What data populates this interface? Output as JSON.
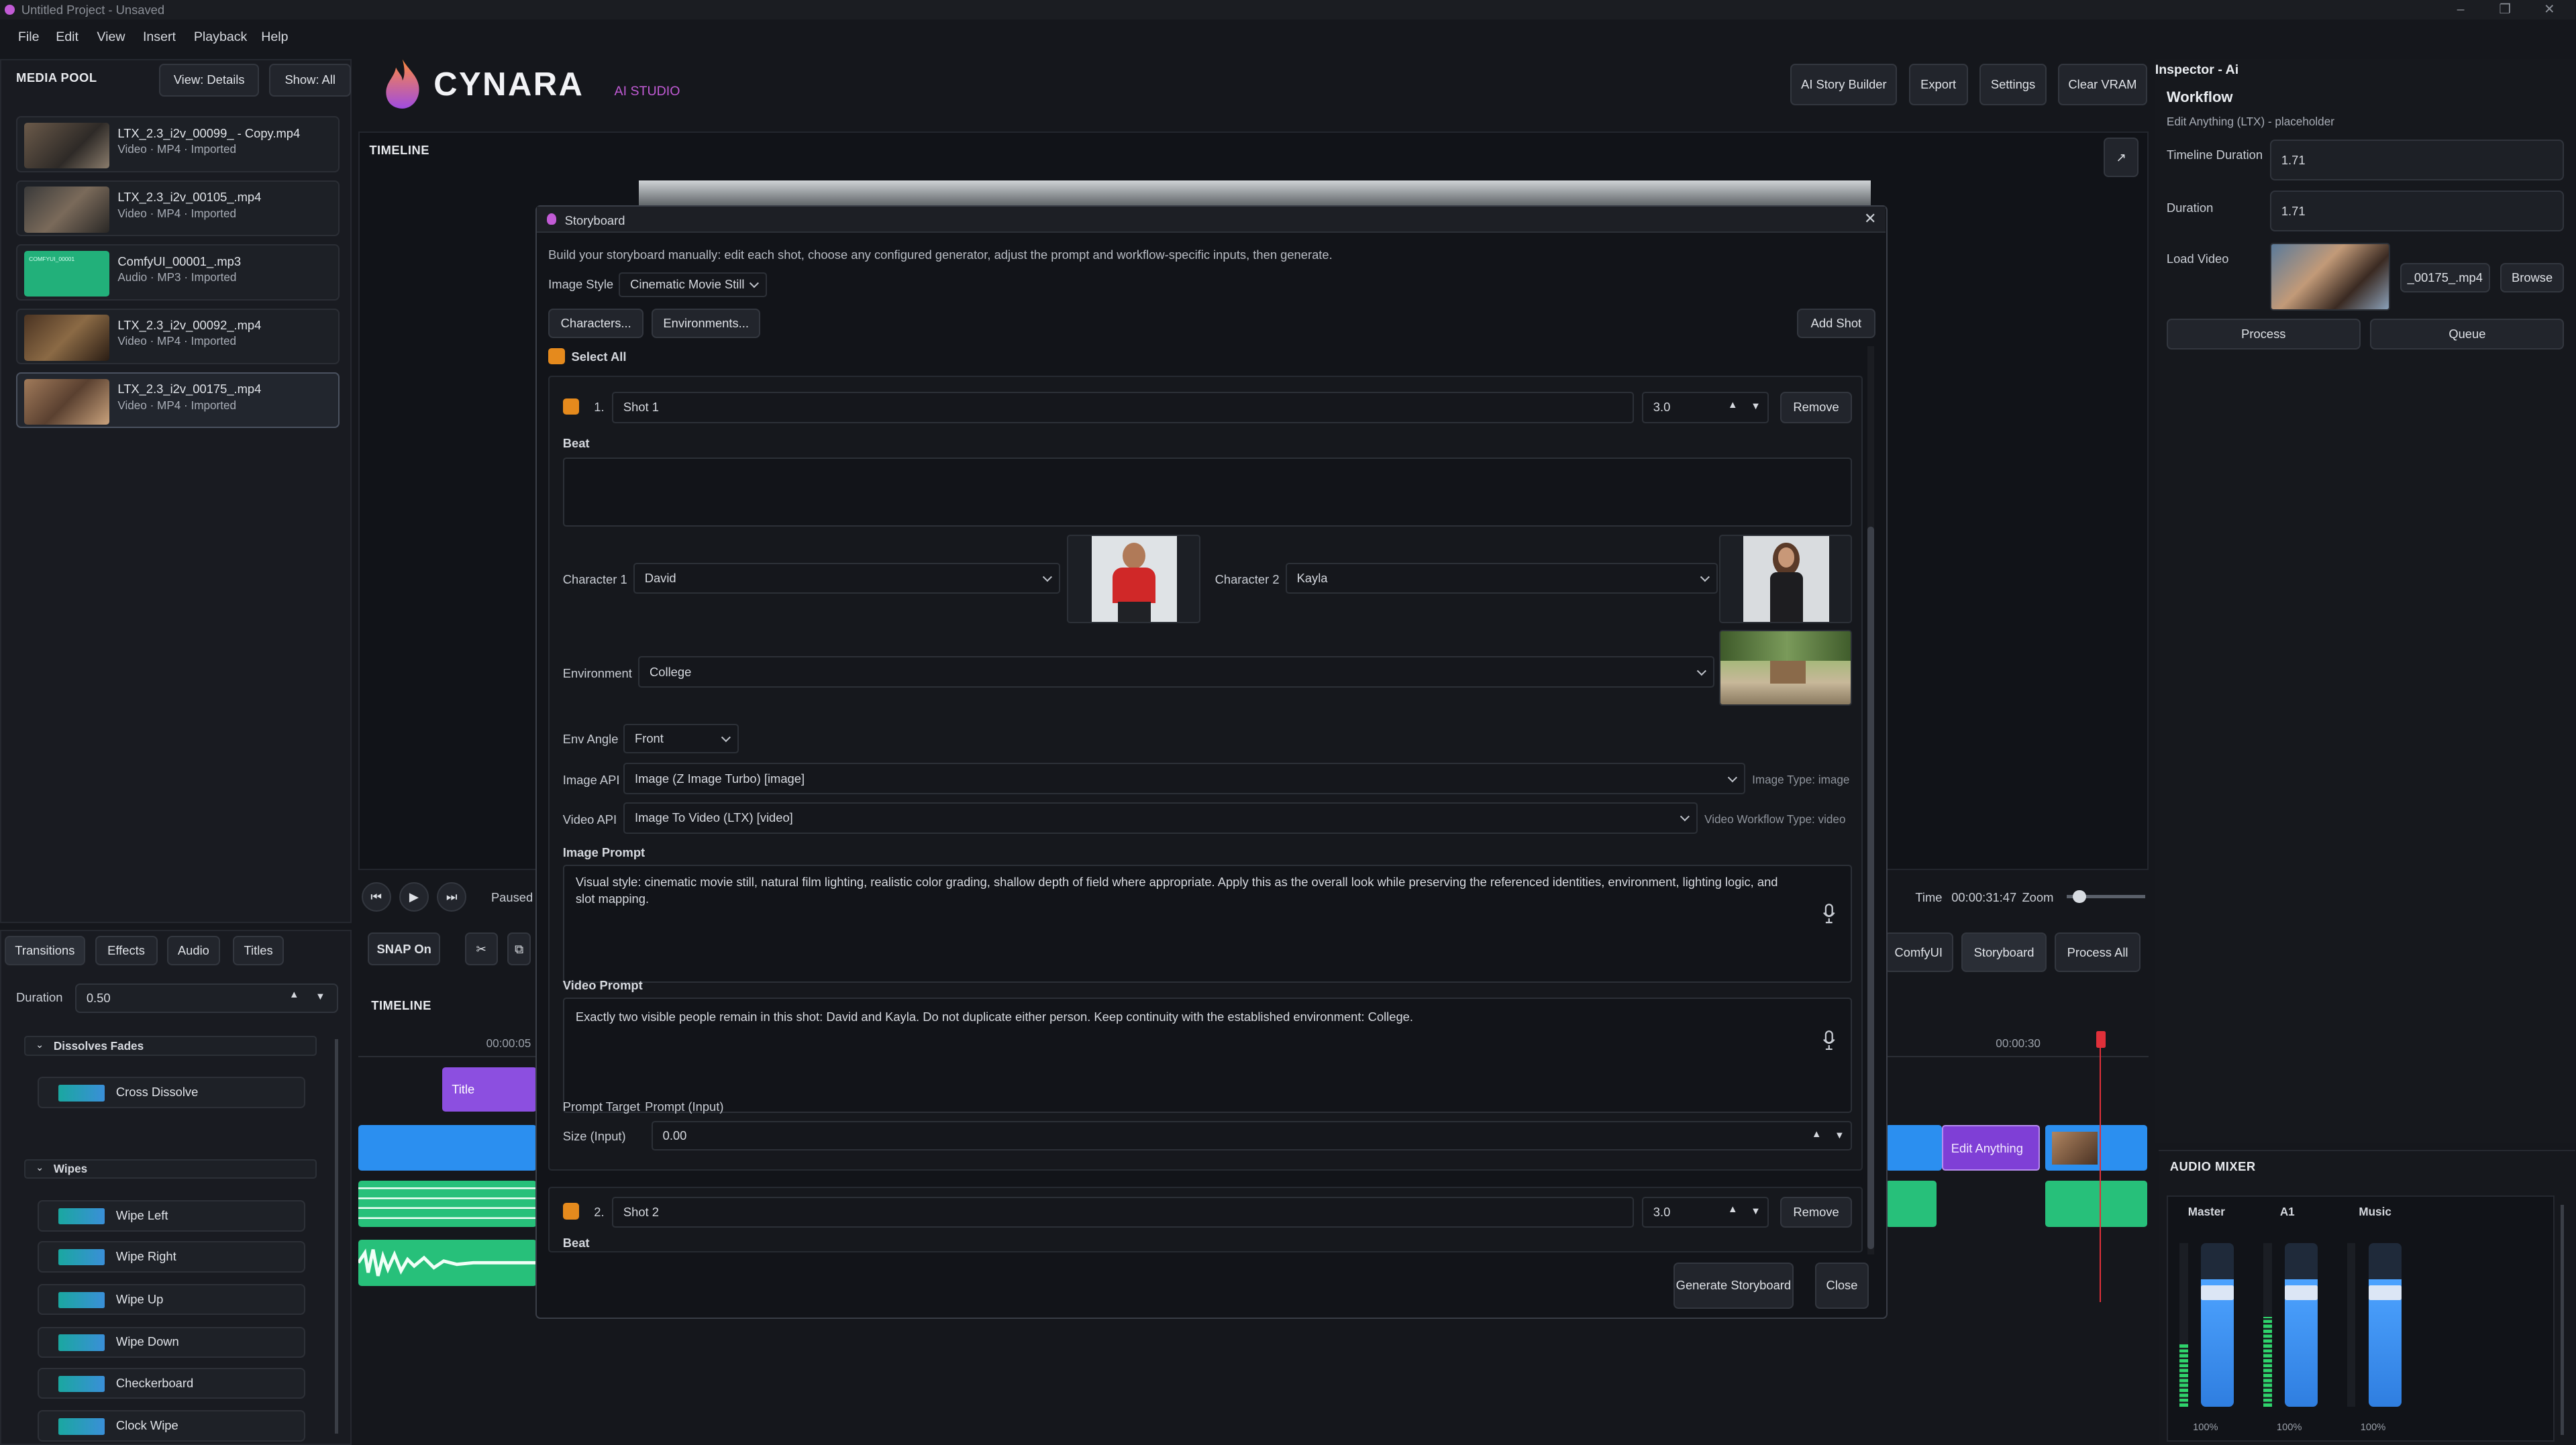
{
  "window": {
    "title": "Untitled Project - Unsaved"
  },
  "menu": [
    "File",
    "Edit",
    "View",
    "Insert",
    "Playback",
    "Help"
  ],
  "media_pool": {
    "title": "MEDIA POOL",
    "view_btn": "View: Details",
    "show_btn": "Show: All",
    "items": [
      {
        "name": "LTX_2.3_i2v_00099_ - Copy.mp4",
        "meta": "Video · MP4 · Imported"
      },
      {
        "name": "LTX_2.3_i2v_00105_.mp4",
        "meta": "Video · MP4 · Imported"
      },
      {
        "name": "ComfyUI_00001_.mp3",
        "meta": "Audio · MP3 · Imported",
        "thumb_text": "COMFYUI_00001"
      },
      {
        "name": "LTX_2.3_i2v_00092_.mp4",
        "meta": "Video · MP4 · Imported"
      },
      {
        "name": "LTX_2.3_i2v_00175_.mp4",
        "meta": "Video · MP4 · Imported"
      }
    ]
  },
  "effects_panel": {
    "tabs": [
      "Transitions",
      "Effects",
      "Audio",
      "Titles"
    ],
    "duration_label": "Duration",
    "duration_value": "0.50",
    "groups": [
      {
        "name": "Dissolves  Fades",
        "items": [
          "Cross Dissolve"
        ]
      },
      {
        "name": "Wipes",
        "items": [
          "Wipe Left",
          "Wipe Right",
          "Wipe Up",
          "Wipe Down",
          "Checkerboard",
          "Clock Wipe"
        ]
      }
    ]
  },
  "brand": {
    "name": "CYNARA",
    "sub": "AI STUDIO"
  },
  "toolbar": {
    "story": "AI Story Builder",
    "export": "Export",
    "settings": "Settings",
    "clear": "Clear VRAM"
  },
  "preview": {
    "label": "TIMELINE",
    "status": "Paused",
    "time_label": "Time",
    "time_value": "00:00:31:47",
    "zoom_label": "Zoom"
  },
  "timeline": {
    "label": "TIMELINE",
    "snap": "SNAP On",
    "comfy": "ComfyUI",
    "storyboard": "Storyboard",
    "process_all": "Process All",
    "ticks": [
      "00:00:05",
      "00:00:30"
    ],
    "title_clip": "Title",
    "edit_clip": "Edit Anything"
  },
  "inspector": {
    "title": "Inspector - Ai",
    "section": "Workflow",
    "subtitle": "Edit Anything (LTX) - placeholder",
    "timeline_duration_label": "Timeline Duration",
    "timeline_duration": "1.71",
    "duration_label": "Duration",
    "duration": "1.71",
    "load_video_label": "Load Video",
    "file": "_00175_.mp4",
    "browse": "Browse",
    "process": "Process",
    "queue": "Queue"
  },
  "mixer": {
    "title": "AUDIO MIXER",
    "channels": [
      {
        "name": "Master",
        "value": "100%"
      },
      {
        "name": "A1",
        "value": "100%"
      },
      {
        "name": "Music",
        "value": "100%"
      }
    ]
  },
  "storyboard": {
    "title": "Storyboard",
    "intro": "Build your storyboard manually: edit each shot, choose any configured generator, adjust the prompt and workflow-specific inputs, then generate.",
    "image_style_label": "Image Style",
    "image_style": "Cinematic Movie Still",
    "characters_btn": "Characters...",
    "environments_btn": "Environments...",
    "add_shot": "Add Shot",
    "select_all": "Select All",
    "shot1": {
      "num": "1.",
      "name": "Shot 1",
      "duration": "3.0",
      "remove": "Remove",
      "beat_label": "Beat",
      "char1_label": "Character 1",
      "char1": "David",
      "char2_label": "Character 2",
      "char2": "Kayla",
      "env_label": "Environment",
      "env": "College",
      "env_angle_label": "Env Angle",
      "env_angle": "Front",
      "image_api_label": "Image API",
      "image_api": "Image (Z Image Turbo) [image]",
      "image_type": "Image Type: image",
      "video_api_label": "Video API",
      "video_api": "Image To Video (LTX) [video]",
      "video_type": "Video Workflow Type: video",
      "image_prompt_label": "Image Prompt",
      "image_prompt": "Visual style: cinematic movie still, natural film lighting, realistic color grading, shallow depth of field where appropriate. Apply this as the overall look while preserving the referenced identities, environment, lighting logic, and slot mapping.",
      "video_prompt_label": "Video Prompt",
      "video_prompt": "Exactly two visible people remain in this shot: David and Kayla. Do not duplicate either person. Keep continuity with the established environment: College.",
      "prompt_target_label": "Prompt Target",
      "prompt_target": "Prompt (Input)",
      "size_label": "Size (Input)",
      "size": "0.00"
    },
    "shot2": {
      "num": "2.",
      "name": "Shot 2",
      "duration": "3.0",
      "remove": "Remove",
      "beat_label": "Beat"
    },
    "generate": "Generate Storyboard",
    "close": "Close"
  },
  "colors": {
    "accent": "#e58a1d",
    "brand_purple": "#c25bd6",
    "clip_blue": "#2b8ff0",
    "clip_green": "#27c07a",
    "clip_purple": "#8c4fe0",
    "playhead": "#e0303a"
  },
  "icons": [
    "flame-logo-icon",
    "close-icon",
    "chevron-down-icon",
    "microphone-icon",
    "play-icon",
    "skip-back-icon",
    "skip-forward-icon",
    "scissors-icon",
    "expand-icon"
  ]
}
